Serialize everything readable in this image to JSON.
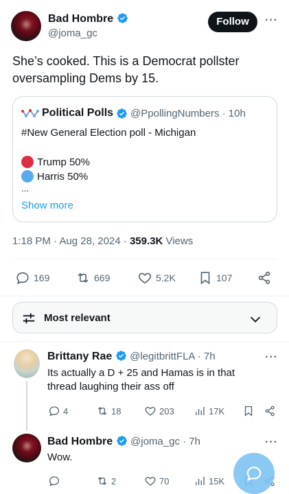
{
  "main_tweet": {
    "author_name": "Bad Hombre",
    "author_handle": "@joma_gc",
    "follow_label": "Follow",
    "more_label": "···",
    "text": "She’s cooked. This is a Democrat pollster oversampling Dems by 15.",
    "time": "1:18 PM · Aug 28, 2024 · ",
    "views_count": "359.3K",
    "views_label": " Views",
    "stats": {
      "replies": "169",
      "reposts": "669",
      "likes": "5.2K",
      "bookmarks": "107"
    }
  },
  "quoted_tweet": {
    "author_name": "Political Polls",
    "author_handle": "@PpollingNumbers · 10h",
    "headline": "#New General Election poll - Michigan",
    "options": [
      {
        "label": "Trump 50%",
        "color": "#dd2e44"
      },
      {
        "label": "Harris 50%",
        "color": "#55acee"
      }
    ],
    "ellipsis": "...",
    "show_more": "Show more"
  },
  "sort": {
    "label": "Most relevant"
  },
  "replies": [
    {
      "author_name": "Brittany Rae",
      "author_handle": "@legitbrittFLA · 7h",
      "text": "Its actually a D + 25 and Hamas is in that thread laughing their ass off",
      "stats": {
        "replies": "4",
        "reposts": "18",
        "likes": "203",
        "views": "17K"
      }
    },
    {
      "author_name": "Bad Hombre",
      "author_handle": "@joma_gc · 7h",
      "text": "Wow.",
      "stats": {
        "replies": "",
        "reposts": "2",
        "likes": "70",
        "views": "15K"
      }
    }
  ],
  "colors": {
    "accent": "#1d9bf0",
    "muted": "#536471",
    "border": "#cfd9de"
  }
}
